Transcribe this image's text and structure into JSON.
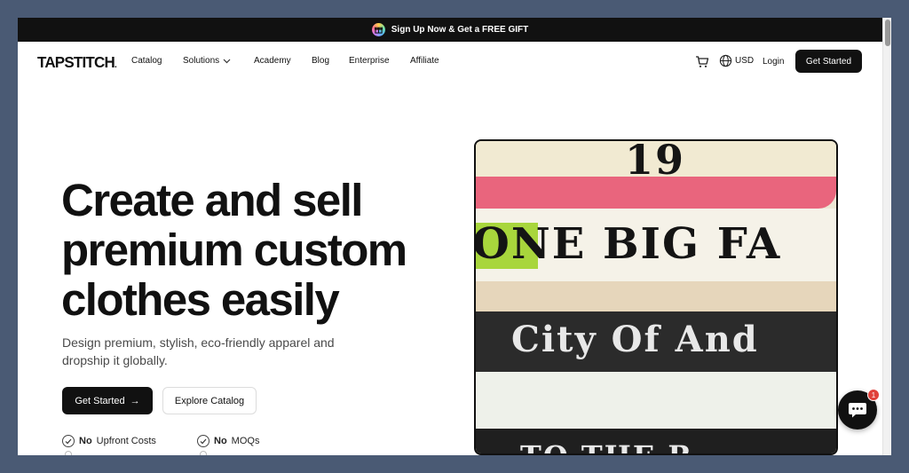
{
  "promo": {
    "text": "Sign Up Now & Get a FREE GIFT",
    "icon": "gift-icon"
  },
  "brand": {
    "logo": "TAPSTITCH",
    "logo_dot": "."
  },
  "nav": {
    "links": [
      {
        "label": "Catalog"
      },
      {
        "label": "Solutions",
        "has_dropdown": true
      },
      {
        "label": "Academy"
      },
      {
        "label": "Blog"
      },
      {
        "label": "Enterprise"
      },
      {
        "label": "Affiliate"
      }
    ],
    "currency": "USD",
    "login": "Login",
    "cta": "Get Started"
  },
  "hero": {
    "title": "Create and sell premium custom clothes easily",
    "subtitle": "Design premium, stylish, eco-friendly apparel and dropship it globally.",
    "primary_cta": "Get Started",
    "primary_cta_icon": "→",
    "secondary_cta": "Explore Catalog",
    "features": [
      {
        "bold": "No",
        "text": "Upfront Costs"
      },
      {
        "bold": "No",
        "text": "MOQs"
      }
    ],
    "image": {
      "shirt_texts": [
        "19",
        "ONE BIG FA",
        "City Of And",
        "TO THE R"
      ]
    }
  },
  "chat": {
    "badge_count": "1"
  },
  "colors": {
    "primary": "#111111",
    "background": "#4a5a74",
    "badge": "#e0413a"
  }
}
